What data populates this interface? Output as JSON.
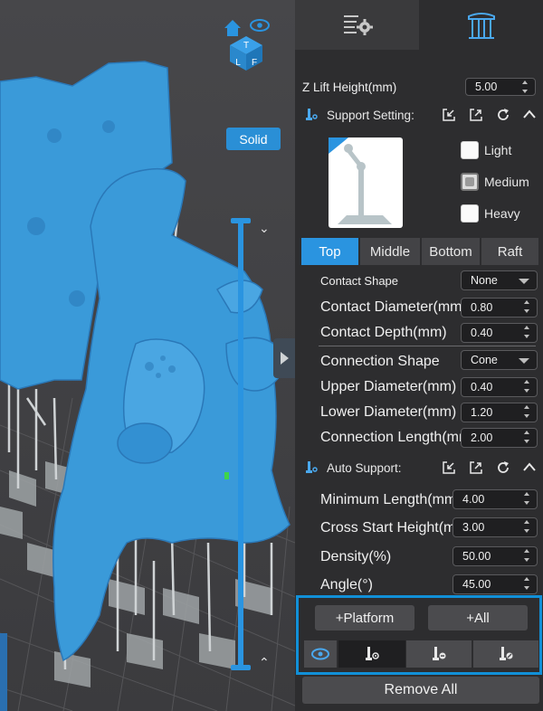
{
  "viewport": {
    "render_mode_label": "Solid",
    "view_cube_letters": [
      "T",
      "L",
      "F"
    ]
  },
  "tabs": [
    {
      "name": "settings",
      "icon": "list-gear-icon",
      "active": false
    },
    {
      "name": "supports",
      "icon": "support-table-icon",
      "active": true
    }
  ],
  "z_lift": {
    "label": "Z Lift Height(mm)",
    "value": "5.00"
  },
  "support_setting": {
    "title": "Support Setting:",
    "presets": [
      {
        "label": "Light",
        "checked": false
      },
      {
        "label": "Medium",
        "checked": true
      },
      {
        "label": "Heavy",
        "checked": false
      }
    ]
  },
  "segments": [
    "Top",
    "Middle",
    "Bottom",
    "Raft"
  ],
  "top_fields": {
    "contact_shape": {
      "label": "Contact Shape",
      "value": "None"
    },
    "contact_diameter": {
      "label": "Contact Diameter(mm)",
      "value": "0.80"
    },
    "contact_depth": {
      "label": "Contact Depth(mm)",
      "value": "0.40"
    },
    "connection_shape": {
      "label": "Connection Shape",
      "value": "Cone"
    },
    "upper_diameter": {
      "label": "Upper Diameter(mm)",
      "value": "0.40"
    },
    "lower_diameter": {
      "label": "Lower Diameter(mm)",
      "value": "1.20"
    },
    "connection_length": {
      "label": "Connection Length(mm)",
      "value": "2.00"
    }
  },
  "auto_support": {
    "title": "Auto Support:",
    "minimum_length": {
      "label": "Minimum Length(mm)",
      "value": "4.00"
    },
    "cross_start_height": {
      "label": "Cross Start Height(mm)",
      "value": "3.00"
    },
    "density": {
      "label": "Density(%)",
      "value": "50.00"
    },
    "angle": {
      "label": "Angle(°)",
      "value": "45.00"
    }
  },
  "actions": {
    "platform": "+Platform",
    "all": "+All",
    "remove_all": "Remove All"
  },
  "colors": {
    "accent": "#2a94e0",
    "highlight_box": "#1190d8",
    "model": "#3a9ad9",
    "support": "#c8cdcf"
  }
}
